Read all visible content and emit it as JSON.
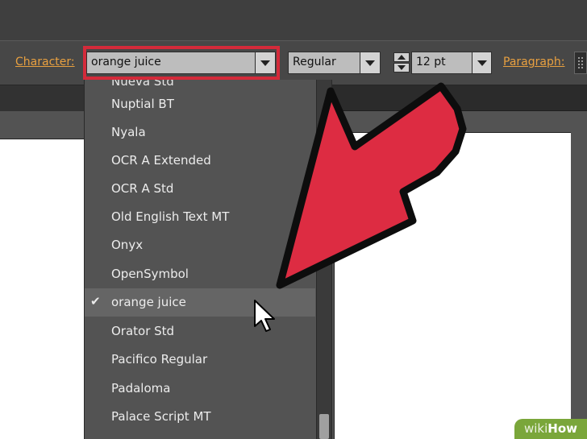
{
  "toolbar": {
    "character_label": "Character:",
    "font_family_value": "orange juice",
    "font_style_value": "Regular",
    "font_size_value": "12 pt",
    "paragraph_label": "Paragraph:"
  },
  "font_menu": {
    "partial_item": "Nueva Std",
    "items": [
      {
        "label": "Nuptial BT",
        "selected": false
      },
      {
        "label": "Nyala",
        "selected": false
      },
      {
        "label": "OCR A Extended",
        "selected": false
      },
      {
        "label": "OCR A Std",
        "selected": false
      },
      {
        "label": "Old English Text MT",
        "selected": false
      },
      {
        "label": "Onyx",
        "selected": false
      },
      {
        "label": "OpenSymbol",
        "selected": false
      },
      {
        "label": "orange juice",
        "selected": true
      },
      {
        "label": "Orator Std",
        "selected": false
      },
      {
        "label": "Pacifico Regular",
        "selected": false
      },
      {
        "label": "Padaloma",
        "selected": false
      },
      {
        "label": "Palace Script MT",
        "selected": false
      }
    ],
    "check_glyph": "✔"
  },
  "watermark": {
    "wiki": "wiki",
    "how": "How"
  },
  "colors": {
    "highlight": "#d42a3a",
    "arrow": "#dd2c42",
    "accent_label": "#e8a040"
  }
}
